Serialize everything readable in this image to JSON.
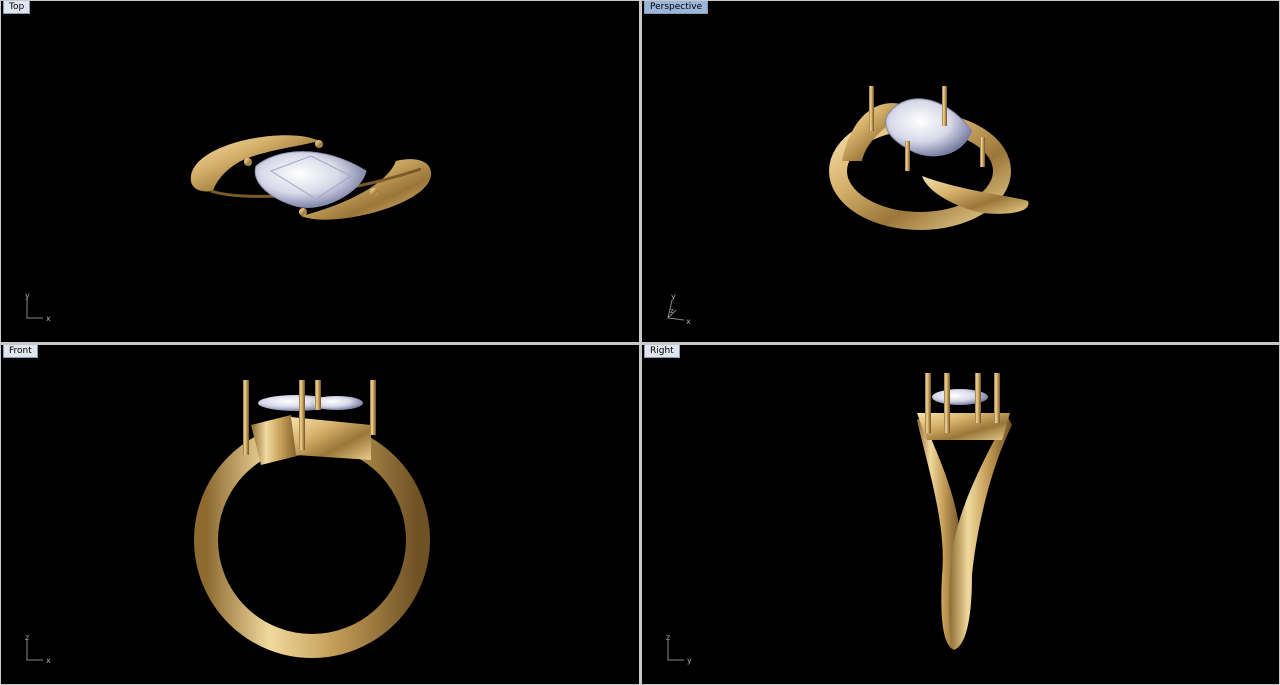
{
  "viewports": {
    "top": {
      "label": "Top",
      "axis_h": "x",
      "axis_v": "y"
    },
    "perspective": {
      "label": "Perspective",
      "axis_h": "x",
      "axis_v": "y",
      "axis_d": "z"
    },
    "front": {
      "label": "Front",
      "axis_h": "x",
      "axis_v": "z"
    },
    "right": {
      "label": "Right",
      "axis_h": "y",
      "axis_v": "z"
    }
  },
  "colors": {
    "viewport_bg": "#000000",
    "frame": "#c8c8c8",
    "gold_light": "#f3dca0",
    "gold_mid": "#c9a35e",
    "gold_dark": "#6b4f22",
    "stone_light": "#f4f5fb",
    "stone_dark": "#5a5f86"
  }
}
